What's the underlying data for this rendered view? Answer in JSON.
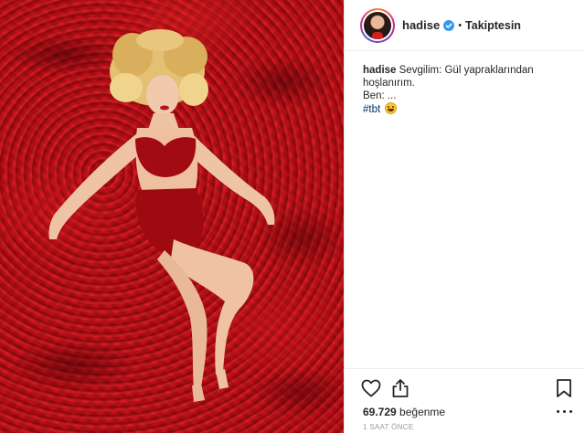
{
  "post": {
    "image_alt": "Photo"
  },
  "header": {
    "username": "hadise",
    "separator": "•",
    "follow_label": "Takiptesin"
  },
  "caption": {
    "username": "hadise",
    "line1": "Sevgilim: Gül yapraklarından hoşlanırım.",
    "line2": "Ben: ...",
    "hashtag": "#tbt"
  },
  "actions": {
    "like_icon": "heart-icon",
    "share_icon": "share-icon",
    "save_icon": "bookmark-icon",
    "more_icon": "more-dots-icon"
  },
  "stats": {
    "likes_count": "69.729",
    "likes_label": "beğenme",
    "time_ago": "1 SAAT ÖNCE"
  },
  "colors": {
    "verified_blue": "#3897f0",
    "hashtag_blue": "#003569",
    "rose_red": "#c4121b"
  }
}
